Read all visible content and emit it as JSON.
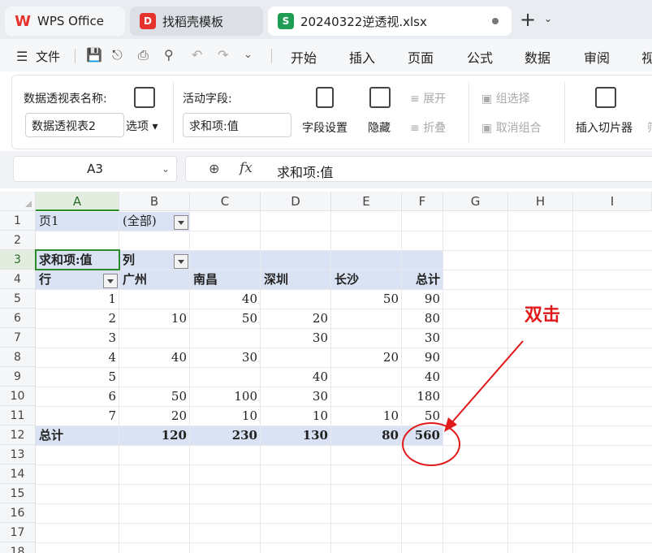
{
  "tabs": [
    {
      "label": "WPS Office"
    },
    {
      "label": "找稻壳模板"
    },
    {
      "label": "20240322逆透视.xlsx"
    }
  ],
  "menubar": {
    "file_label": "文件",
    "items": [
      "开始",
      "插入",
      "页面",
      "公式",
      "数据",
      "审阅",
      "视"
    ]
  },
  "ribbon": {
    "pivot_name_label": "数据透视表名称:",
    "pivot_name_value": "数据透视表2",
    "options_label": "选项",
    "active_field_label": "活动字段:",
    "active_field_value": "求和项:值",
    "field_settings_label": "字段设置",
    "hide_label": "隐藏",
    "expand_label": "展开",
    "collapse_label": "折叠",
    "group_select_label": "组选择",
    "ungroup_label": "取消组合",
    "insert_slicer_label": "插入切片器",
    "cut_off_label": "筛"
  },
  "formula_bar": {
    "name_box": "A3",
    "formula": "求和项:值"
  },
  "columns": [
    "A",
    "B",
    "C",
    "D",
    "E",
    "F",
    "G",
    "H",
    "I"
  ],
  "rows": [
    "1",
    "2",
    "3",
    "4",
    "5",
    "6",
    "7",
    "8",
    "9",
    "10",
    "11",
    "12",
    "13",
    "14",
    "15",
    "16",
    "17",
    "18"
  ],
  "pivot": {
    "page_label": "页1",
    "page_value": "(全部)",
    "sum_label": "求和项:值",
    "col_label": "列",
    "row_label": "行",
    "headers": [
      "广州",
      "南昌",
      "深圳",
      "长沙",
      "总计"
    ],
    "data": [
      [
        "1",
        "",
        "40",
        "",
        "50",
        "90"
      ],
      [
        "2",
        "10",
        "50",
        "20",
        "",
        "80"
      ],
      [
        "3",
        "",
        "",
        "30",
        "",
        "30"
      ],
      [
        "4",
        "40",
        "30",
        "",
        "20",
        "90"
      ],
      [
        "5",
        "",
        "",
        "40",
        "",
        "40"
      ],
      [
        "6",
        "50",
        "100",
        "30",
        "",
        "180"
      ],
      [
        "7",
        "20",
        "10",
        "10",
        "10",
        "50"
      ]
    ],
    "total_label": "总计",
    "totals": [
      "120",
      "230",
      "130",
      "80",
      "560"
    ]
  },
  "annotation": {
    "text": "双击",
    "color": "#e0191b"
  },
  "colors": {
    "pivot_band": "#dae3f3",
    "selection": "#2d8a2a"
  }
}
